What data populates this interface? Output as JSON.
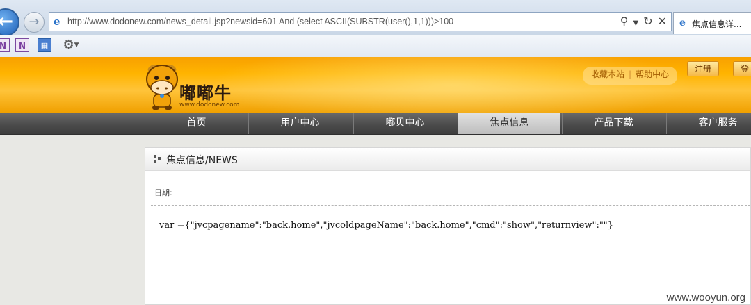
{
  "browser": {
    "url": "http://www.dodonew.com/news_detail.jsp?newsid=601 And (select ASCII(SUBSTR(user(),1,1)))>100",
    "tab_title": "焦点信息详..."
  },
  "header": {
    "logo_text": "嘟嘟牛",
    "logo_url": "www.dodonew.com",
    "links": [
      "收藏本站",
      "帮助中心"
    ],
    "register_label": "注册",
    "login_label": "登"
  },
  "nav": {
    "items": [
      {
        "label": "首页"
      },
      {
        "label": "用户中心"
      },
      {
        "label": "嘟贝中心"
      },
      {
        "label": "焦点信息"
      },
      {
        "label": "产品下载"
      },
      {
        "label": "客户服务"
      }
    ],
    "active_index": 3
  },
  "content": {
    "section_title": "焦点信息/NEWS",
    "date_label": "日期:",
    "body_text": "var ={\"jvcpagename\":\"back.home\",\"jvcoldpageName\":\"back.home\",\"cmd\":\"show\",\"returnview\":\"\"}"
  },
  "watermark": "www.wooyun.org",
  "colors": {
    "header_orange": "#ffb400",
    "nav_dark": "#4a4a4a",
    "nav_active": "#cfcfcf",
    "link_orange": "#a25a00"
  }
}
